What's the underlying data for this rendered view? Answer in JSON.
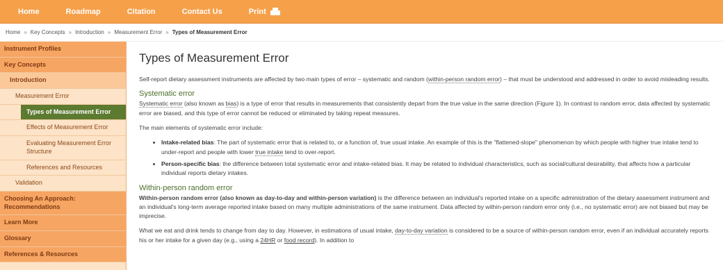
{
  "topnav": {
    "items": [
      {
        "label": "Home"
      },
      {
        "label": "Roadmap"
      },
      {
        "label": "Citation"
      },
      {
        "label": "Contact Us"
      },
      {
        "label": "Print"
      }
    ]
  },
  "breadcrumb": {
    "items": [
      "Home",
      "Key Concepts",
      "Introduction",
      "Measurement Error"
    ],
    "separator": "»",
    "current": "Types of Measurement Error"
  },
  "sidebar": {
    "items": [
      {
        "label": "Instrument Profiles",
        "level": "top"
      },
      {
        "label": "Key Concepts",
        "level": "top"
      },
      {
        "label": "Introduction",
        "level": "l1"
      },
      {
        "label": "Measurement Error",
        "level": "l2"
      },
      {
        "label": "Types of Measurement Error",
        "level": "l3-active"
      },
      {
        "label": "Effects of Measurement Error",
        "level": "l3"
      },
      {
        "label": "Evaluating Measurement Error Structure",
        "level": "l3"
      },
      {
        "label": "References and Resources",
        "level": "l3"
      },
      {
        "label": "Validation",
        "level": "l2"
      },
      {
        "label": "Choosing An Approach: Recommendations",
        "level": "top"
      },
      {
        "label": "Learn More",
        "level": "top"
      },
      {
        "label": "Glossary",
        "level": "top"
      },
      {
        "label": "References & Resources",
        "level": "top"
      }
    ]
  },
  "main": {
    "title": "Types of Measurement Error",
    "intro_a": "Self-report dietary assessment instruments are affected by two main types of error – systematic and random (",
    "intro_link": "within-person random error",
    "intro_b": ") – that must be understood and addressed in order to avoid misleading results.",
    "systematic": {
      "heading": "Systematic error",
      "p1_link": "Systematic error",
      "p1_a": " (also known as ",
      "p1_bias": "bias",
      "p1_b": ") is a type of error that results in measurements that consistently depart from the true value in the same direction (Figure 1). In contrast to random error, data affected by systematic error are biased, and this type of error cannot be reduced or eliminated by taking repeat measures.",
      "p2": "The main elements of systematic error include:",
      "bullets": [
        {
          "term": "Intake-related bias",
          "text_a": ": The part of systematic error that is related to, or a function of, true usual intake. An example of this is the \"flattened-slope\" phenomenon by which people with higher true intake tend to under-report and people with lower ",
          "link": "true intake",
          "text_b": " tend to over-report."
        },
        {
          "term": "Person-specific bias",
          "text_a": ": the difference between total systematic error and intake-related bias. It may be related to individual characteristics, such as social/cultural desirability, that affects how a particular individual reports dietary intakes.",
          "link": "",
          "text_b": ""
        }
      ]
    },
    "random": {
      "heading": "Within-person random error",
      "p1_bold": "Within-person random error (also known as day-to-day and within-person variation)",
      "p1_rest": " is the difference between an individual's reported intake on a specific administration of the dietary assessment instrument and an individual's long-term average reported intake based on many multiple administrations of the same instrument. Data affected by within-person random error only (i.e., no systematic error) are not biased but may be imprecise.",
      "p2_a": "What we eat and drink tends to change from day to day. However, in estimations of usual intake, ",
      "p2_link1": "day-to-day variation",
      "p2_b": " is considered to be a source of within-person random error, even if an individual accurately reports his or her intake for a given day (e.g., using a ",
      "p2_link2": "24HR",
      "p2_c": " or ",
      "p2_link3": "food record",
      "p2_d": "). In addition to"
    }
  }
}
